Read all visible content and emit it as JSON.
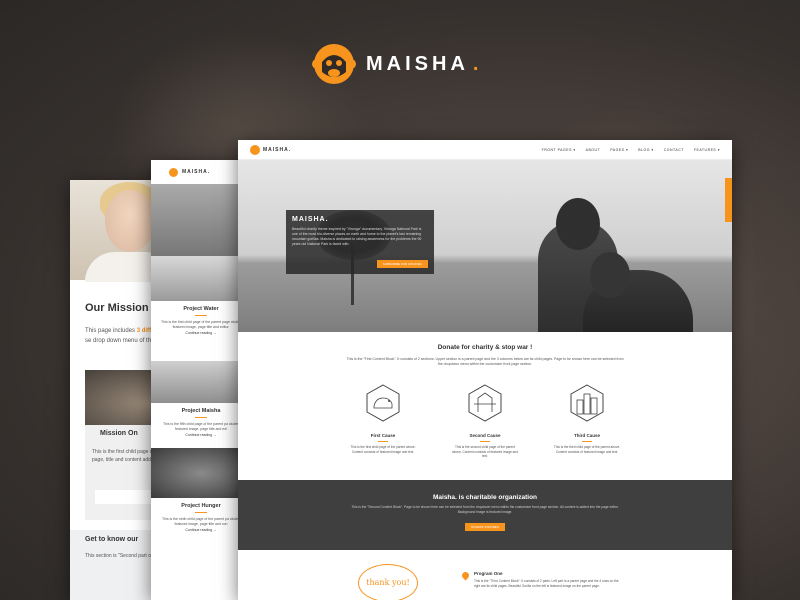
{
  "brand": {
    "name": "MAISHA",
    "dot": ".",
    "accent_color": "#f7941d"
  },
  "card1": {
    "mission_title": "Our Mission",
    "mission_text_a": "This page includes ",
    "mission_text_hl": "3 diff",
    "mission_text_b": "\"First Content Block\" se drop down menu of the A",
    "box_title": "Mission On",
    "box_text": "This is the first child page of Mission\" parent. It includes page, title and content adde editor.",
    "box_button": "Continue reading",
    "know_title": "Get to know our",
    "know_text": "This section is \"Second part on the left and the f"
  },
  "card2": {
    "logo_name": "MAISHA.",
    "items": [
      {
        "title": "Project Water",
        "text": "This is the first child page of the parent page cludes featured image, page title and editor.",
        "more": "Continue reading →"
      },
      {
        "title": "Project Maisha",
        "text": "This is the fifth child page of the parent pa cludes featured image, page title and edi",
        "more": "Continue reading →"
      },
      {
        "title": "Project Hunger",
        "text": "This is the ninth child page of the parent pa cludes featured image, page title and con",
        "more": "Continue reading →"
      }
    ]
  },
  "card3": {
    "logo_name": "MAISHA.",
    "menu": [
      "FRONT PAGES ▾",
      "ABOUT",
      "PAGES ▾",
      "BLOG ▾",
      "CONTACT",
      "FEATURES ▾"
    ],
    "hero": {
      "title": "MAISHA.",
      "text": "Beautiful charity theme inspired by \"Virunga\" documentary. Virunga National Park is one of the most bio-diverse places on earth and home to the planet's last remaining mountain gorillas. Maisha is dedicated to raising awareness for the problems the 90 years old National Park is faced with.",
      "button": "SUBSCRIBE FOR UPDATES"
    },
    "donate": {
      "title": "Donate for charity & stop war !",
      "text": "This is the \"First Content Block\". It consists of 2 sections. Upper section is a parent page and the 3 columns below are its child pages. Page to be shown here can be selected from the dropdown menu within the customizer front page section."
    },
    "causes": [
      {
        "title": "First Cause",
        "text": "This is the first child page of the parent above. Content consists of featured image and text."
      },
      {
        "title": "Second Cause",
        "text": "This is the second child page of the parent above. Content consists of featured image and text."
      },
      {
        "title": "Third Cause",
        "text": "This is the third child page of the parent above. Content consists of featured image and text."
      }
    ],
    "dark": {
      "title": "Maisha. is charitable organization",
      "text": "This is the \"Second Content Block\". Page to be shown here can be selected from the dropdown menu within the customizer front page section. All content is added into the page editor. Background image is featured image.",
      "button": "DONATE STROBES"
    },
    "thanks": "thank you!",
    "program_title": "Program One",
    "program_text": "This is the \"Third Content Block\". It consists of 2 parts. Left part is a parent page and the 4 rows on the right are its child pages. Beautiful Gorilla on the left is featured image on the parent page."
  }
}
